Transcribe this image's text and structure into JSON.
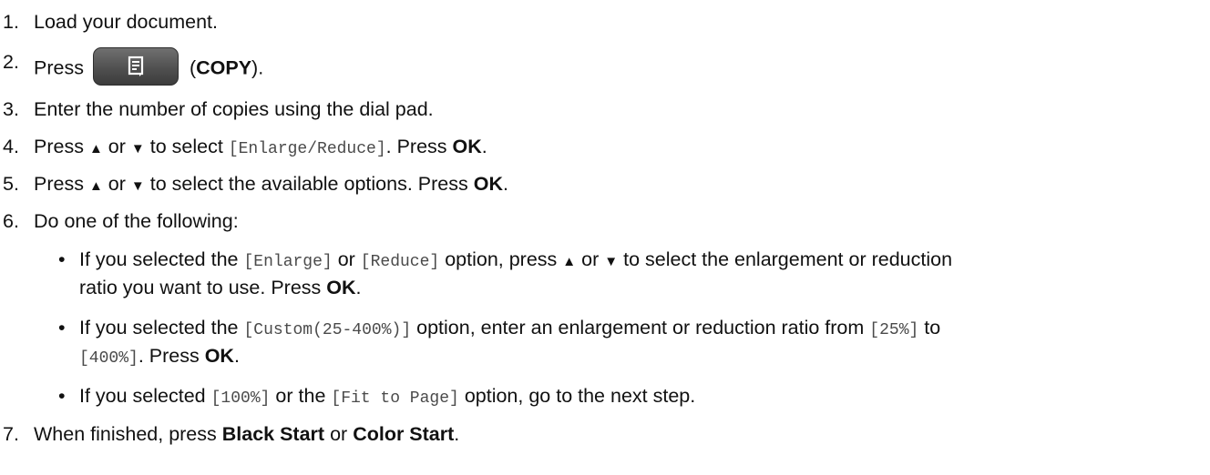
{
  "steps": [
    {
      "n": "1.",
      "text": "Load your document."
    },
    {
      "n": "2.",
      "pre": "Press",
      "post_open": "(",
      "bold": "COPY",
      "post_close": ")."
    },
    {
      "n": "3.",
      "text": "Enter the number of copies using the dial pad."
    },
    {
      "n": "4.",
      "a": "Press",
      "up": "▲",
      "or": "or",
      "down": "▼",
      "b": "to select",
      "mono": "[Enlarge/Reduce]",
      "c": ". Press",
      "ok": "OK",
      "d": "."
    },
    {
      "n": "5.",
      "a": "Press",
      "up": "▲",
      "or": "or",
      "down": "▼",
      "b": "to select the available options. Press",
      "ok": "OK",
      "d": "."
    },
    {
      "n": "6.",
      "text": "Do one of the following:"
    },
    {
      "n": "7.",
      "a": "When finished, press",
      "b1": "Black Start",
      "or": "or",
      "b2": "Color Start",
      "d": "."
    }
  ],
  "bullets": [
    {
      "mark": "•",
      "a": "If you selected the",
      "m1": "[Enlarge]",
      "or": "or",
      "m2": "[Reduce]",
      "b": "option, press",
      "up": "▲",
      "or2": "or",
      "down": "▼",
      "c": "to select the enlargement or reduction",
      "line2": "ratio you want to use. Press",
      "ok": "OK",
      "d": "."
    },
    {
      "mark": "•",
      "a": "If you selected the",
      "m1": "[Custom(25-400%)]",
      "b": "option, enter an enlargement or reduction ratio from",
      "m2": "[25%]",
      "c": "to",
      "m3": "[400%]",
      "e": ". Press",
      "ok": "OK",
      "d": "."
    },
    {
      "mark": "•",
      "a": "If you selected",
      "m1": "[100%]",
      "or": "or the",
      "m2": "[Fit to Page]",
      "b": "option, go to the next step."
    }
  ],
  "icons": {
    "copy_button": "copy-document-icon"
  },
  "colors": {
    "button_dark": "#505050",
    "mono_text": "#4a4a4a"
  }
}
